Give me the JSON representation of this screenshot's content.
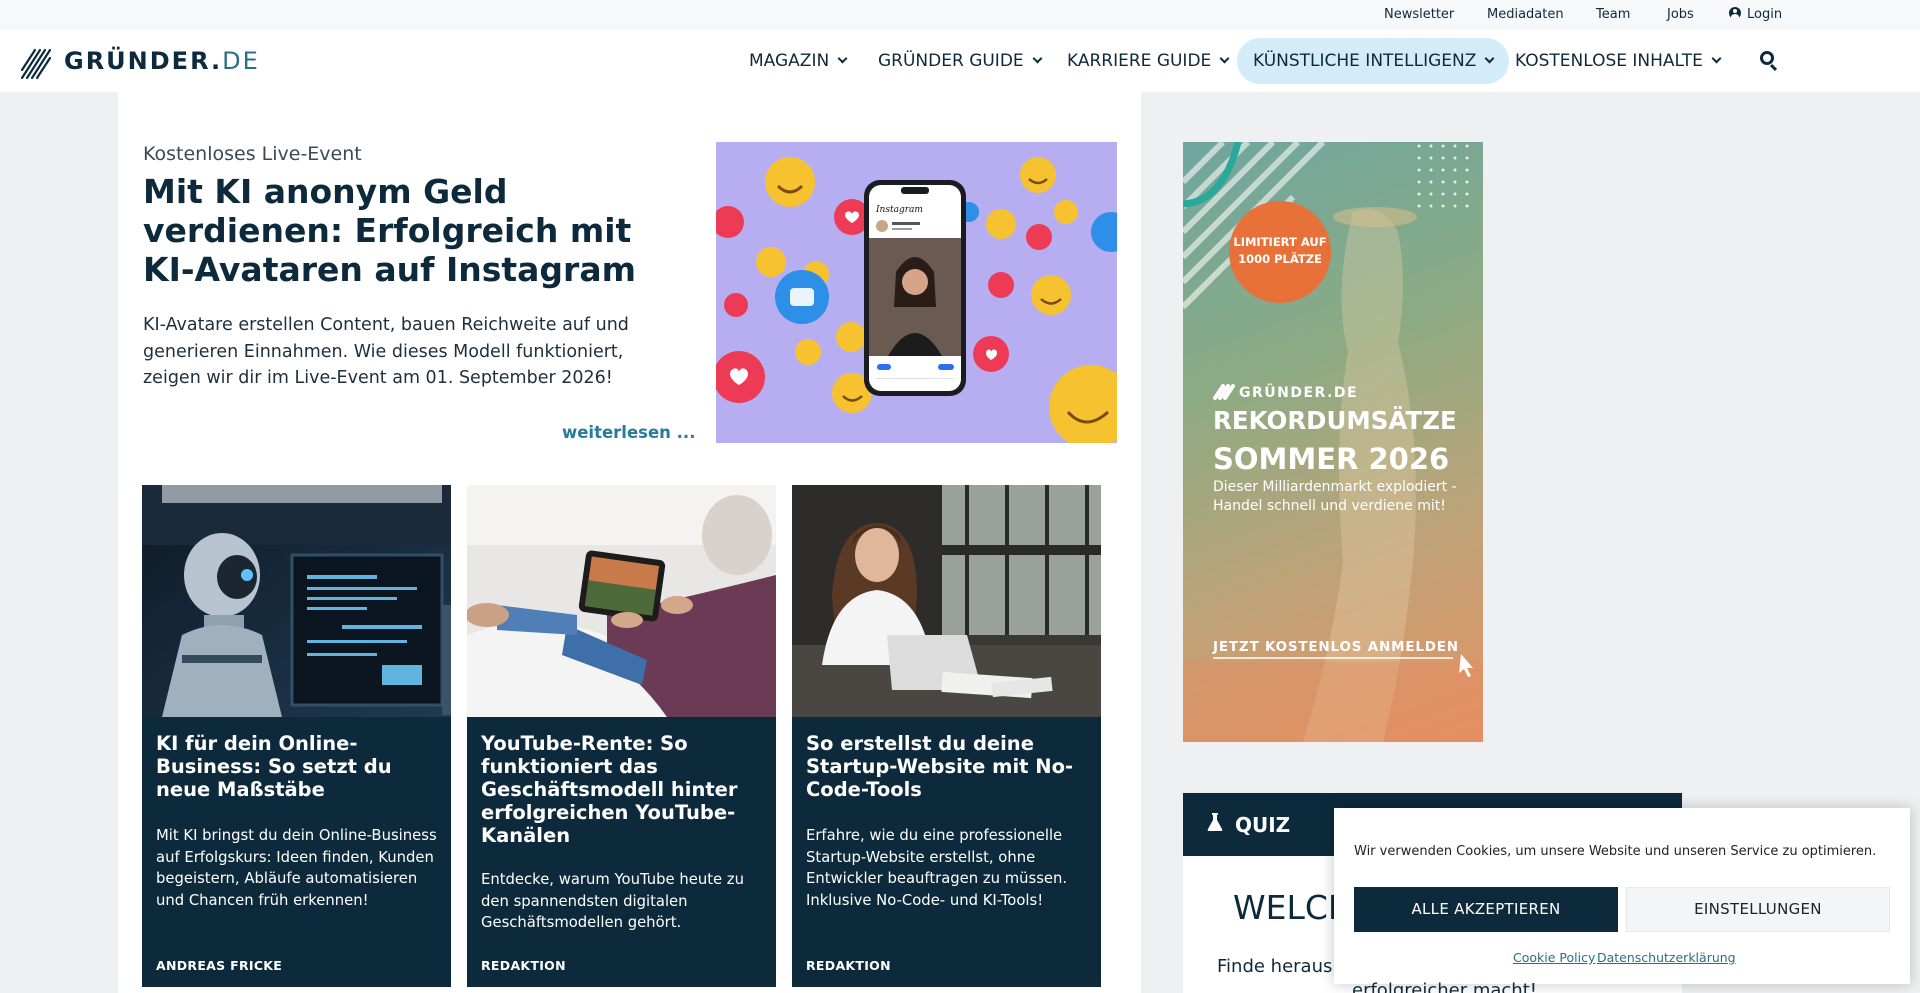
{
  "topbar": {
    "links": [
      "Newsletter",
      "Mediadaten",
      "Team",
      "Jobs"
    ],
    "login_label": "Login"
  },
  "header": {
    "logo_main": "GRÜNDER.",
    "logo_suffix": "DE",
    "nav": [
      {
        "label": "MAGAZIN",
        "active": false
      },
      {
        "label": "GRÜNDER GUIDE",
        "active": false
      },
      {
        "label": "KARRIERE GUIDE",
        "active": false
      },
      {
        "label": "KÜNSTLICHE INTELLIGENZ",
        "active": true
      },
      {
        "label": "KOSTENLOSE INHALTE",
        "active": false
      }
    ]
  },
  "hero": {
    "kicker": "Kostenloses Live-Event",
    "title": "Mit KI anonym Geld verdienen: Erfolgreich mit KI-Avataren auf Instagram",
    "text": "KI-Avatare erstellen Content, bauen Reichweite auf und generieren Einnahmen. Wie dieses Modell funktioniert, zeigen wir dir im Live-Event am 01. September 2026!",
    "read_more": "weiterlesen ..."
  },
  "cards": [
    {
      "title": "KI für dein Online-Business: So setzt du neue Maßstäbe",
      "desc": "Mit KI bringst du dein Online-Business auf Erfolgskurs: Ideen finden, Kunden begeistern, Abläufe automatisieren und Chancen früh erkennen!",
      "author": "ANDREAS FRICKE"
    },
    {
      "title": "YouTube-Rente: So funktioniert das Geschäftsmodell hinter erfolgreichen YouTube-Kanälen",
      "desc": "Entdecke, warum YouTube heute zu den spannendsten digitalen Geschäftsmodellen gehört.",
      "author": "REDAKTION"
    },
    {
      "title": "So erstellst du deine Startup-Website mit No-Code-Tools",
      "desc": "Erfahre, wie du eine professionelle Startup-Website erstellst, ohne Entwickler beauftragen zu müssen. Inklusive No-Code- und KI-Tools!",
      "author": "REDAKTION"
    }
  ],
  "ad": {
    "badge_line1": "LIMITIERT AUF",
    "badge_line2": "1000 PLÄTZE",
    "brand": "GRÜNDER.DE",
    "headline1": "REKORDUMSÄTZE",
    "headline2": "SOMMER 2026",
    "sub": "Dieser Milliardenmarkt explodiert - Handel schnell und verdiene mit!",
    "cta": "JETZT KOSTENLOS ANMELDEN"
  },
  "quiz": {
    "label": "QUIZ",
    "heading": "WELCH",
    "text": "Finde heraus, w",
    "text_overflow": "erfolgreicher macht!"
  },
  "cookie": {
    "text": "Wir verwenden Cookies, um unsere Website und unseren Service zu optimieren.",
    "accept": "ALLE AKZEPTIEREN",
    "settings": "EINSTELLUNGEN",
    "link1": "Cookie Policy",
    "link2": "Datenschutzerklärung"
  },
  "colors": {
    "navy": "#0d2a3d",
    "active_nav_bg": "#d4ecf9",
    "link": "#2a7a99"
  }
}
